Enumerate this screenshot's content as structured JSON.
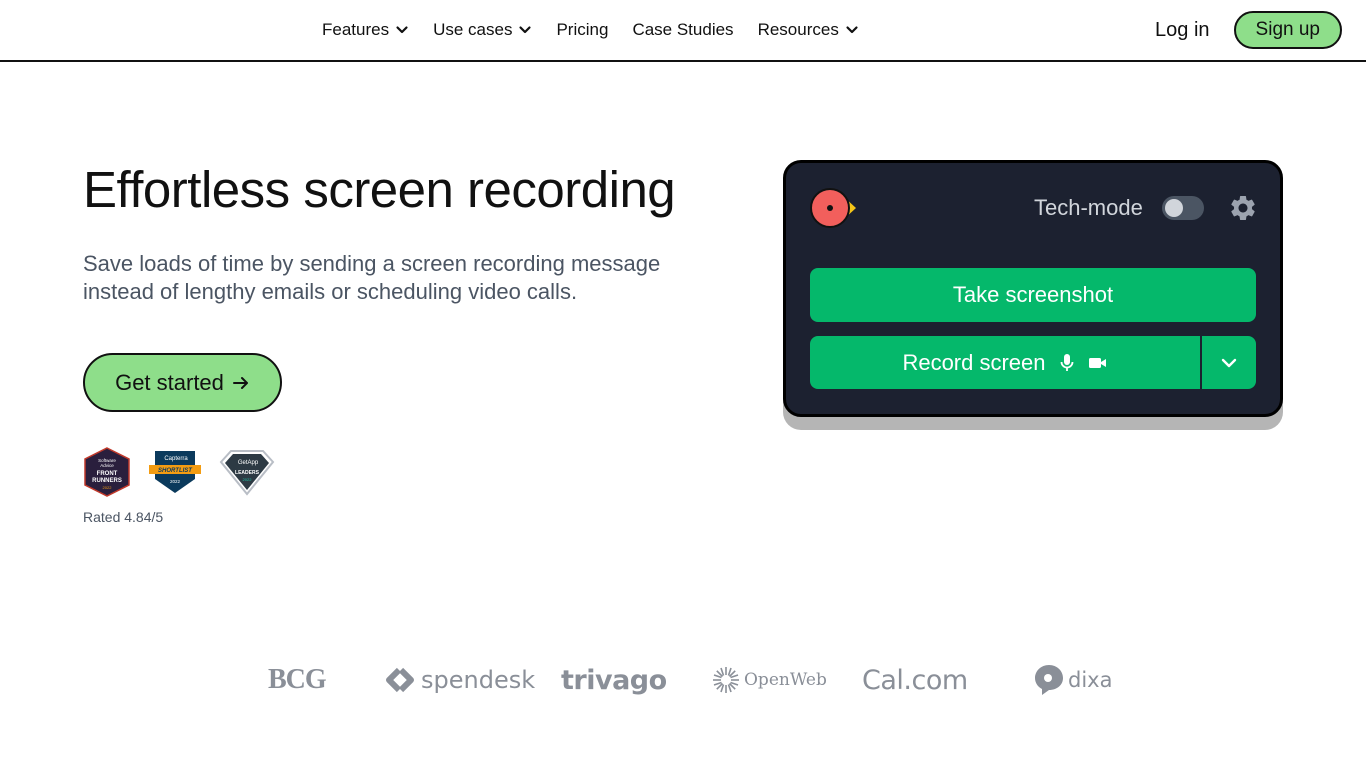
{
  "nav": {
    "items": [
      {
        "label": "Features",
        "dropdown": true
      },
      {
        "label": "Use cases",
        "dropdown": true
      },
      {
        "label": "Pricing",
        "dropdown": false
      },
      {
        "label": "Case Studies",
        "dropdown": false
      },
      {
        "label": "Resources",
        "dropdown": true
      }
    ],
    "login_label": "Log in",
    "signup_label": "Sign up"
  },
  "hero": {
    "title": "Effortless screen recording",
    "subtitle": "Save loads of time by sending a screen recording message instead of lengthy emails or scheduling video calls.",
    "cta_label": "Get started",
    "cta_icon": "arrow-right-icon",
    "badges": [
      {
        "name": "software-advice-front-runners-badge",
        "lines": [
          "Software",
          "Advice",
          "FRONT",
          "RUNNERS",
          "2022"
        ]
      },
      {
        "name": "capterra-shortlist-badge",
        "lines": [
          "Capterra",
          "SHORTLIST",
          "2022"
        ]
      },
      {
        "name": "getapp-leaders-badge",
        "lines": [
          "GetApp",
          "LEADERS",
          "2022"
        ]
      }
    ],
    "rating": "Rated 4.84/5"
  },
  "widget": {
    "tech_mode_label": "Tech-mode",
    "tech_mode_on": false,
    "screenshot_label": "Take screenshot",
    "record_label": "Record screen",
    "icons": [
      "app-logo-icon",
      "gear-icon",
      "microphone-icon",
      "camera-icon",
      "chevron-down-icon"
    ]
  },
  "logos": {
    "bcg": "BCG",
    "spendesk": "spendesk",
    "trivago": "trivago",
    "openweb": "OpenWeb",
    "cal": "Cal.com",
    "dixa": "dixa"
  },
  "colors": {
    "accent_green": "#8ede8a",
    "widget_bg": "#1c2130",
    "button_green": "#05b86b",
    "logo_red": "#f25f5c",
    "logo_yellow": "#f5c518",
    "muted_text": "#4b5563",
    "logo_gray": "#8a8f98"
  }
}
